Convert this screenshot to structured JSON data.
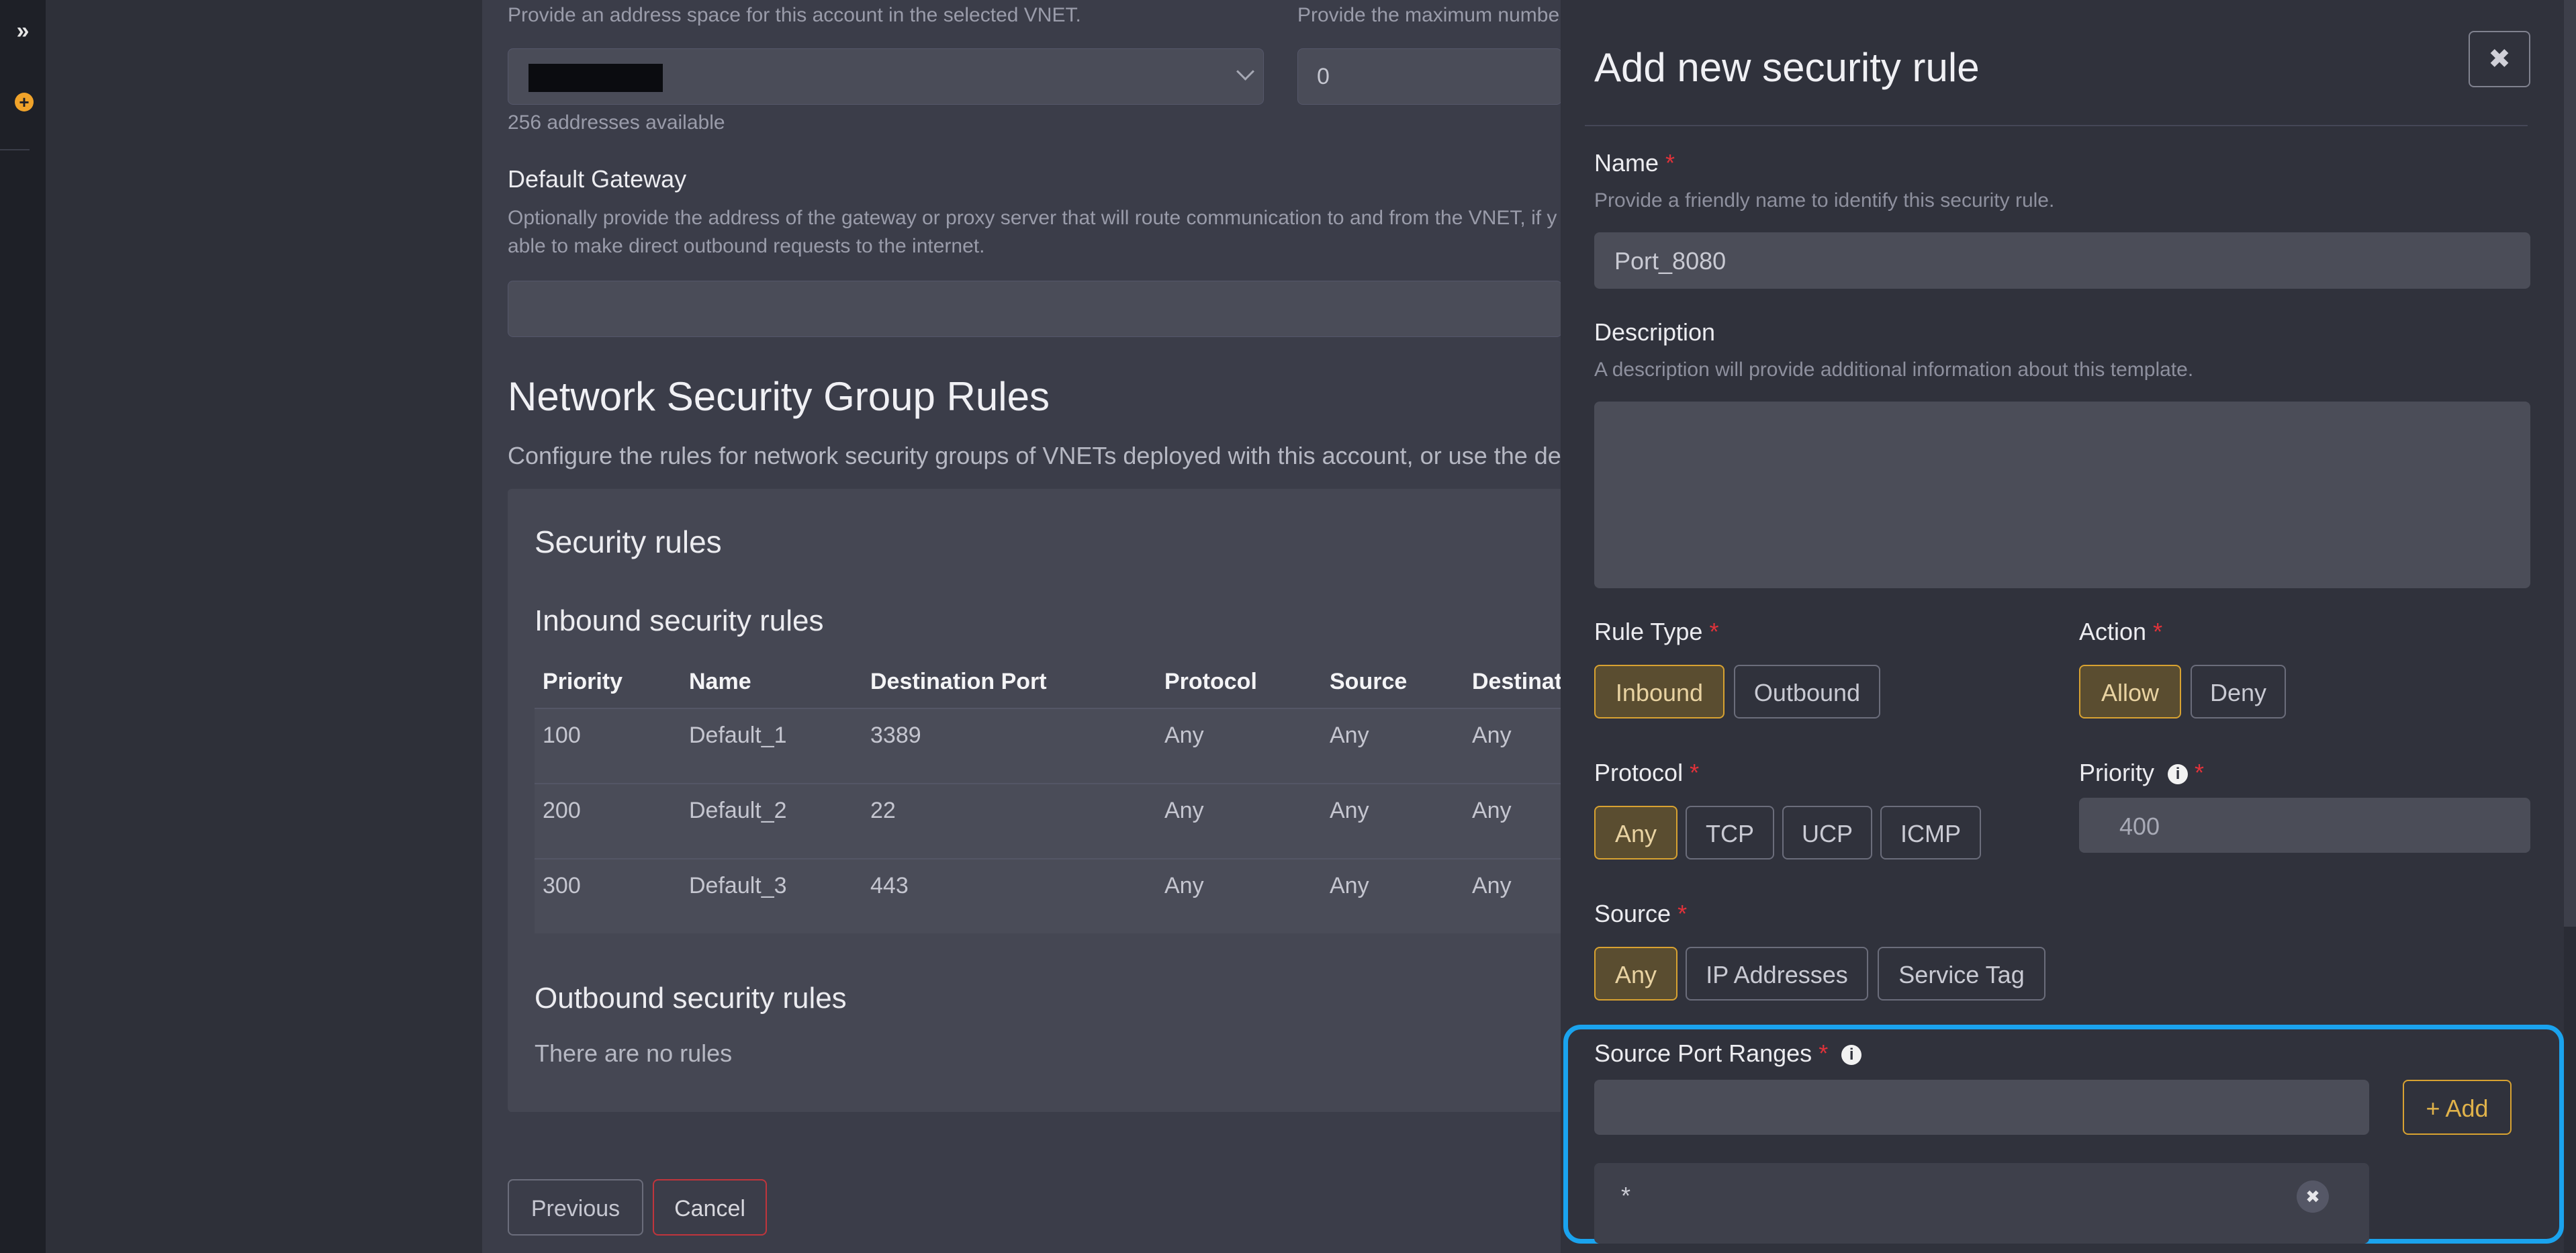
{
  "rail": {
    "expand_icon": "double-chevron-right-icon",
    "add_icon": "plus-circle-icon"
  },
  "form": {
    "address_space_help": "Provide an address space for this account in the selected VNET.",
    "max_help": "Provide the maximum numbe",
    "max_value": "0",
    "addresses_available": "256 addresses available",
    "gateway_label": "Default Gateway",
    "gateway_help_1": "Optionally provide the address of the gateway or proxy server that will route communication to and from the VNET, if y",
    "gateway_help_2": "able to make direct outbound requests to the internet."
  },
  "nsg": {
    "title": "Network Security Group Rules",
    "description": "Configure the rules for network security groups of VNETs deployed with this account, or use the defa",
    "security_rules_title": "Security rules",
    "inbound_title": "Inbound security rules",
    "columns": [
      "Priority",
      "Name",
      "Destination Port",
      "Protocol",
      "Source",
      "Destinat"
    ],
    "rows": [
      [
        "100",
        "Default_1",
        "3389",
        "Any",
        "Any",
        "Any"
      ],
      [
        "200",
        "Default_2",
        "22",
        "Any",
        "Any",
        "Any"
      ],
      [
        "300",
        "Default_3",
        "443",
        "Any",
        "Any",
        "Any"
      ]
    ],
    "outbound_title": "Outbound security rules",
    "no_rules": "There are no rules"
  },
  "footer": {
    "previous": "Previous",
    "cancel": "Cancel"
  },
  "dialog": {
    "title": "Add new security rule",
    "close_icon": "close-icon",
    "name_label": "Name",
    "name_help": "Provide a friendly name to identify this security rule.",
    "name_value": "Port_8080",
    "description_label": "Description",
    "description_help": "A description will provide additional information about this template.",
    "rule_type_label": "Rule Type",
    "rule_type_options": [
      "Inbound",
      "Outbound"
    ],
    "rule_type_selected": "Inbound",
    "action_label": "Action",
    "action_options": [
      "Allow",
      "Deny"
    ],
    "action_selected": "Allow",
    "protocol_label": "Protocol",
    "protocol_options": [
      "Any",
      "TCP",
      "UCP",
      "ICMP"
    ],
    "protocol_selected": "Any",
    "priority_label": "Priority",
    "priority_value": "400",
    "source_label": "Source",
    "source_options": [
      "Any",
      "IP Addresses",
      "Service Tag"
    ],
    "source_selected": "Any",
    "source_port_ranges_label": "Source Port Ranges",
    "add_label": "+ Add",
    "port_entries": [
      "*"
    ],
    "required_mark": "*"
  },
  "colors": {
    "accent": "#d8a231",
    "highlight": "#1aa3ee",
    "required": "#e0323a",
    "cancel_border": "#c0353c"
  }
}
